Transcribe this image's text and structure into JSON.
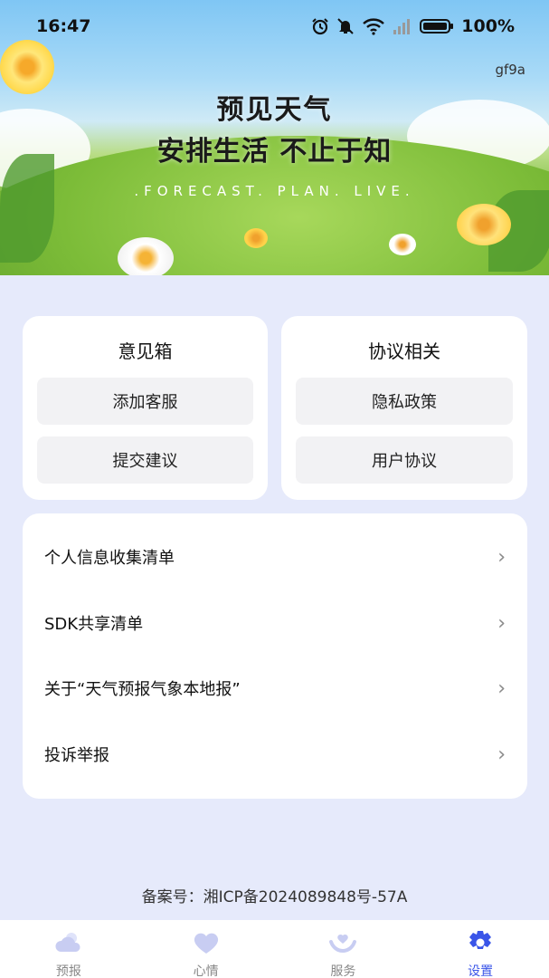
{
  "status": {
    "time": "16:47",
    "battery": "100%"
  },
  "header": {
    "code_tag": "gf9a",
    "slogan_line1": "预见天气",
    "slogan_line2": "安排生活 不止于知",
    "slogan_en": ".FORECAST. PLAN. LIVE."
  },
  "feedback_card": {
    "title": "意见箱",
    "buttons": [
      "添加客服",
      "提交建议"
    ]
  },
  "agreement_card": {
    "title": "协议相关",
    "buttons": [
      "隐私政策",
      "用户协议"
    ]
  },
  "list": [
    {
      "label": "个人信息收集清单"
    },
    {
      "label": "SDK共享清单"
    },
    {
      "label": "关于“天气预报气象本地报”"
    },
    {
      "label": "投诉举报"
    }
  ],
  "footer": {
    "icp": "备案号：湘ICP备2024089848号-57A"
  },
  "tabs": [
    {
      "label": "预报",
      "icon": "cloud-sun-icon"
    },
    {
      "label": "心情",
      "icon": "heart-icon"
    },
    {
      "label": "服务",
      "icon": "hands-heart-icon"
    },
    {
      "label": "设置",
      "icon": "gear-icon",
      "active": true
    }
  ],
  "colors": {
    "accent": "#3a55e8",
    "background": "#e6eafb",
    "tab_inactive": "#c8cdf2"
  }
}
